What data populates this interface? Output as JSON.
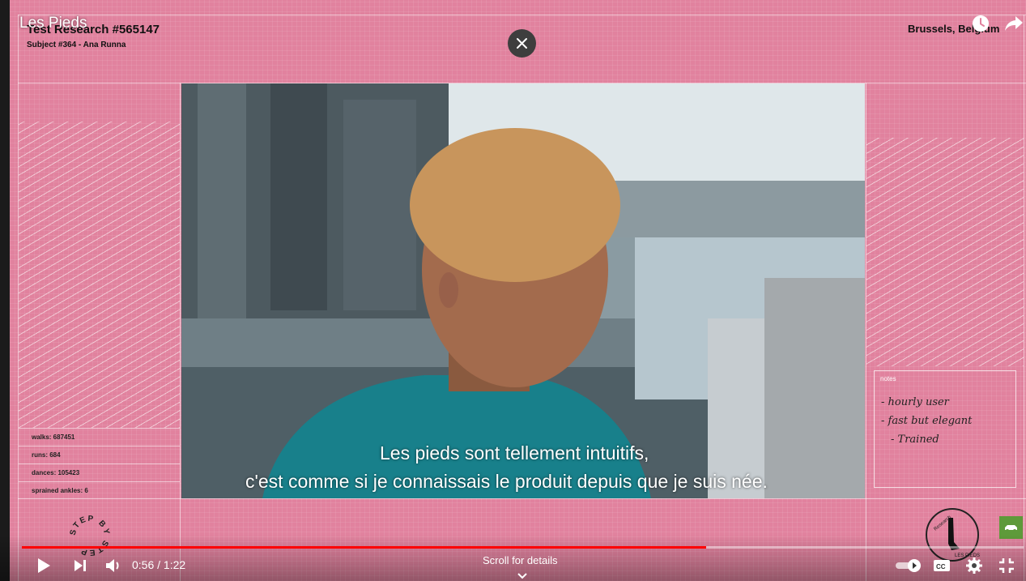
{
  "player": {
    "title": "Les Pieds",
    "time": "0:56 / 1:22",
    "progress_fraction": 0.683,
    "scroll_hint": "Scroll for details",
    "accent_color": "#ff0000"
  },
  "overlay": {
    "research_title": "Test Research #565147",
    "subject": "Subject #364 - Ana Runna",
    "location": "Brussels, Belgium"
  },
  "stats": [
    "walks: 687451",
    "runs: 684",
    "dances: 105423",
    "sprained ankles: 6"
  ],
  "notes": {
    "label": "notes",
    "items": [
      "- hourly user",
      "- fast but elegant",
      "- Trained"
    ]
  },
  "subtitles": {
    "line1": "Les pieds sont tellement intuitifs,",
    "line2": "c'est comme si je connaissais le produit depuis que je suis née."
  },
  "logos": {
    "left_stamp": "STEP BY STEP",
    "right_stamp": "Research LES PIEDS"
  },
  "icons": [
    "clock-icon",
    "share-icon",
    "close-icon",
    "play-icon",
    "next-icon",
    "volume-icon",
    "autoplay-toggle-icon",
    "cc-icon",
    "gear-icon",
    "exit-fullscreen-icon",
    "chevron-down-icon"
  ]
}
